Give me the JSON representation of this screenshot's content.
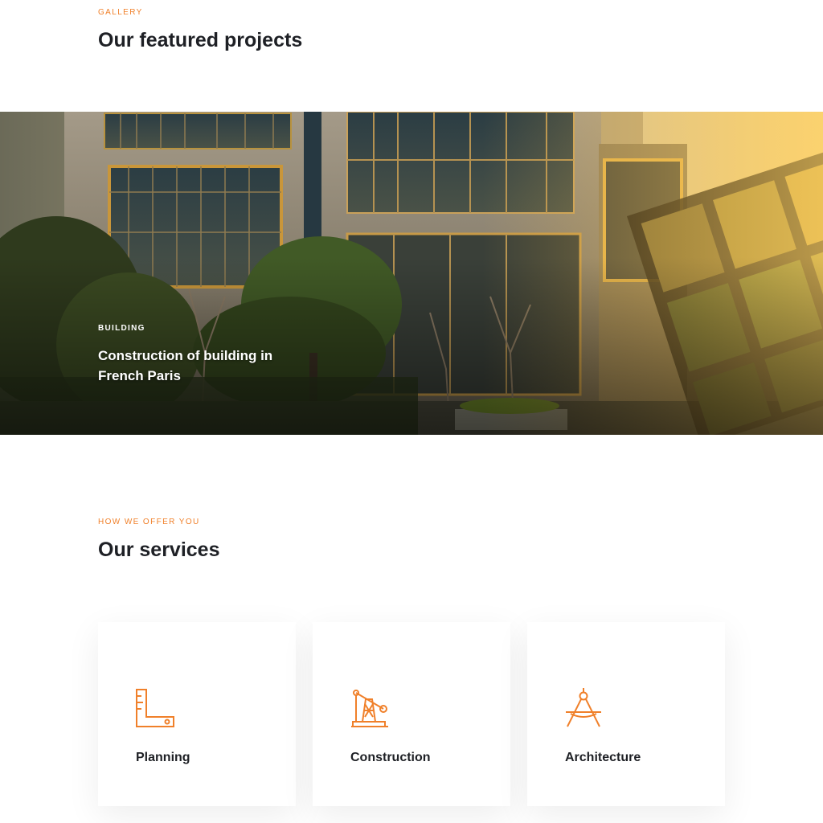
{
  "gallery": {
    "eyebrow": "GALLERY",
    "title": "Our featured projects"
  },
  "featured_project": {
    "category": "BUILDING",
    "title": "Construction of building in French Paris",
    "image": "modern-glass-building-photo"
  },
  "services": {
    "eyebrow": "HOW WE OFFER YOU",
    "title": "Our services",
    "items": [
      {
        "label": "Planning",
        "icon": "set-square-ruler-icon"
      },
      {
        "label": "Construction",
        "icon": "crane-tower-icon"
      },
      {
        "label": "Architecture",
        "icon": "drafting-compass-icon"
      }
    ]
  },
  "colors": {
    "accent": "#f0802a",
    "heading": "#1e2025",
    "card_bg": "#ffffff"
  }
}
